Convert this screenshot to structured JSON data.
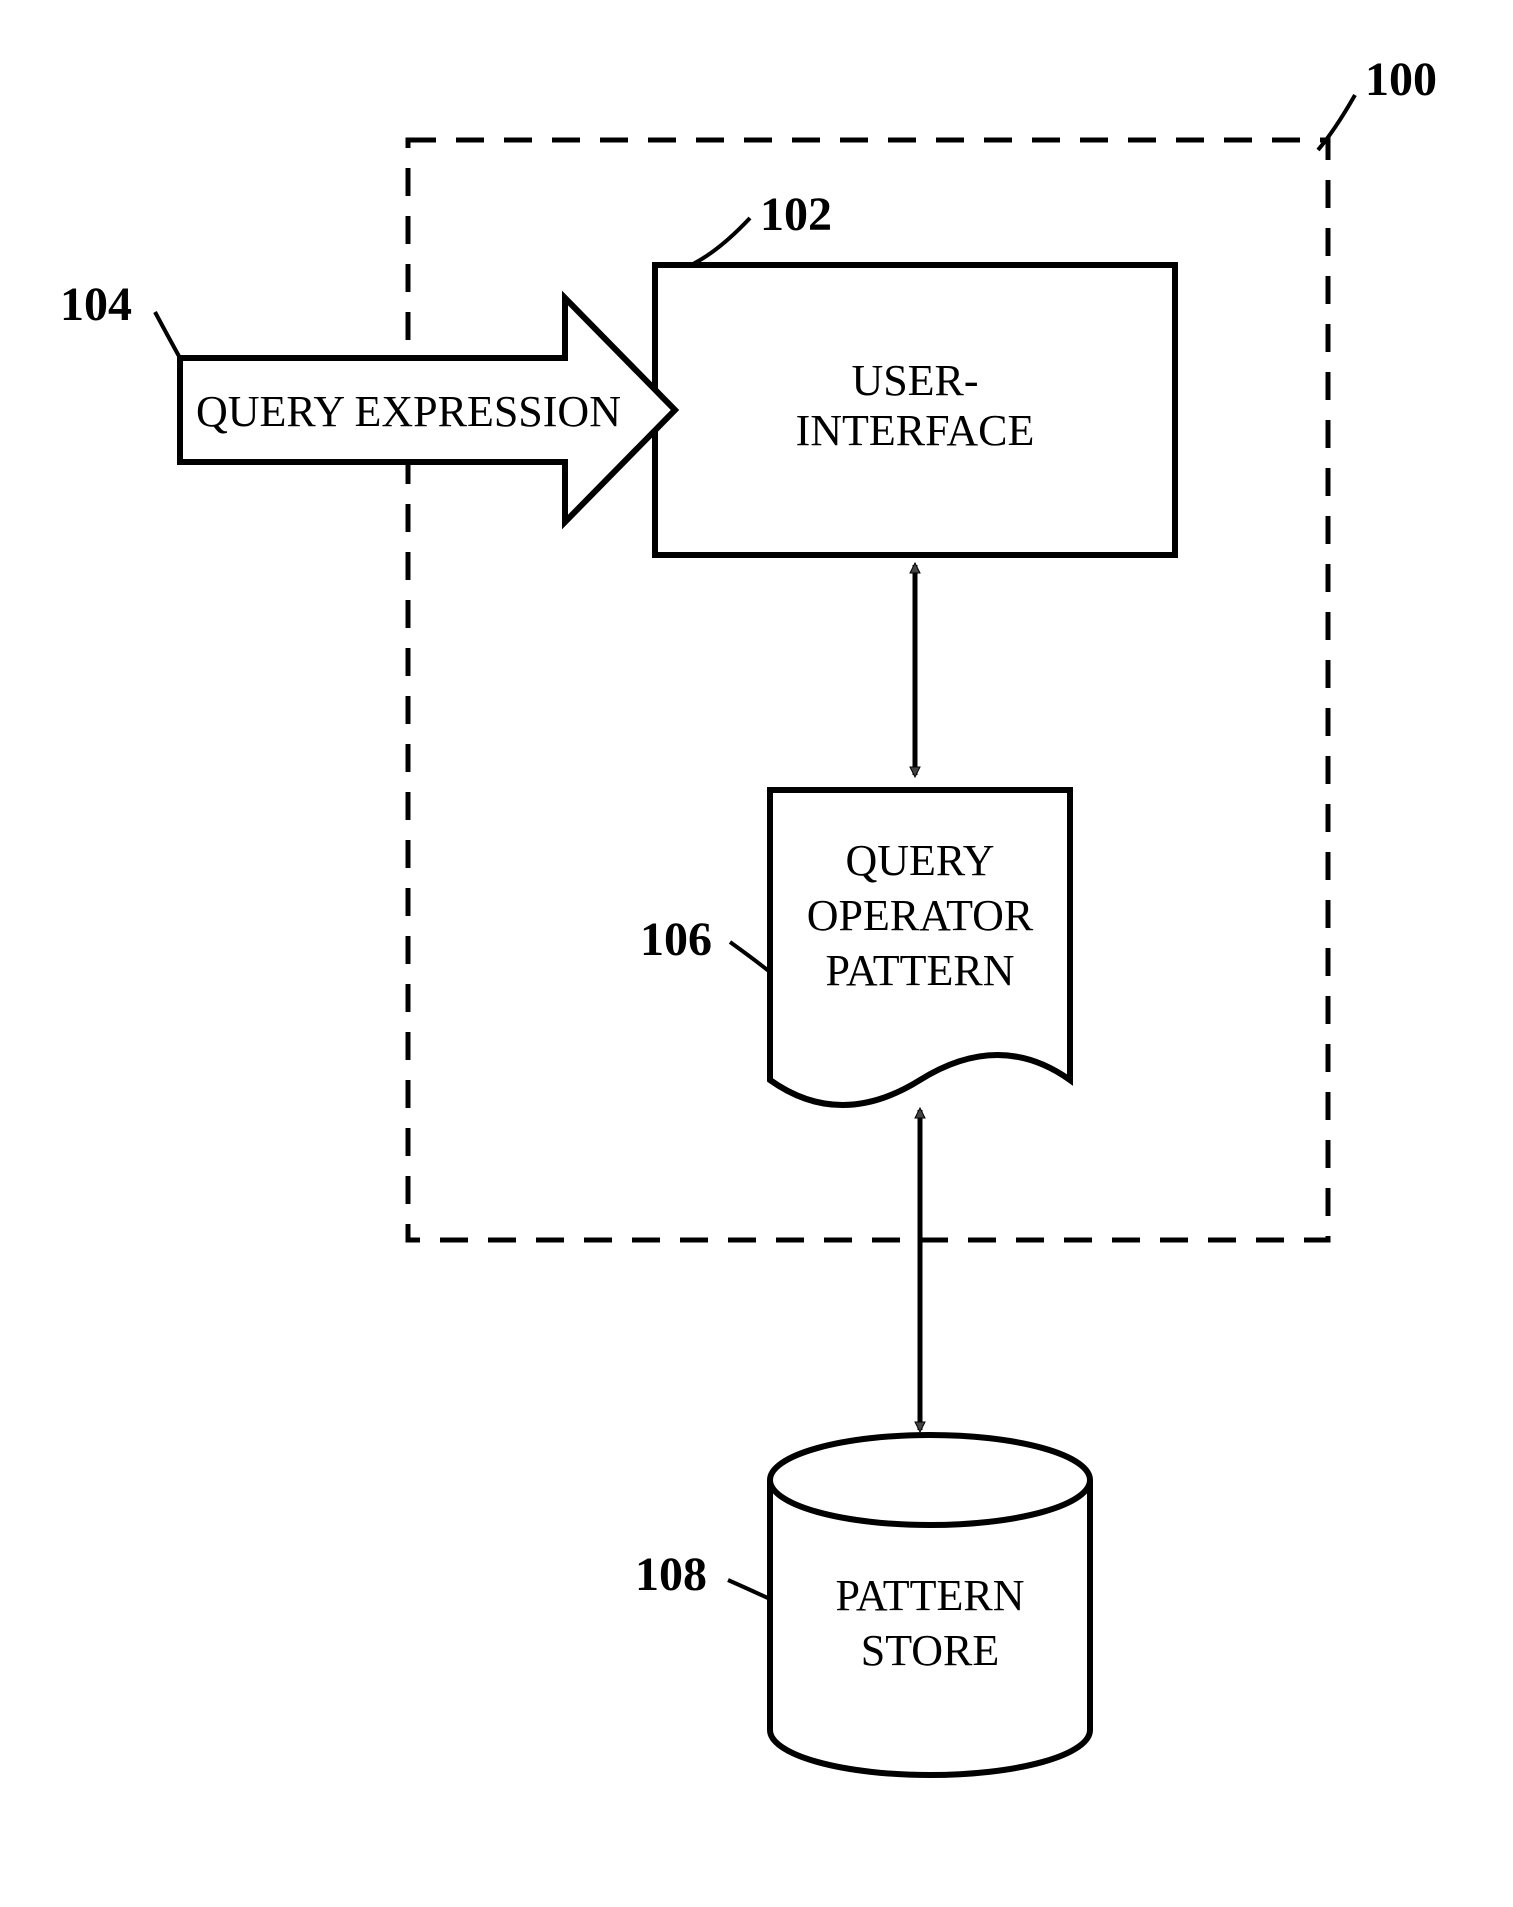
{
  "refs": {
    "system": "100",
    "ui": "102",
    "query_expression": "104",
    "pattern_doc": "106",
    "store": "108"
  },
  "labels": {
    "query_expression": "QUERY EXPRESSION",
    "ui_line1": "USER-",
    "ui_line2": "INTERFACE",
    "pattern_line1": "QUERY",
    "pattern_line2": "OPERATOR",
    "pattern_line3": "PATTERN",
    "store_line1": "PATTERN",
    "store_line2": "STORE"
  }
}
